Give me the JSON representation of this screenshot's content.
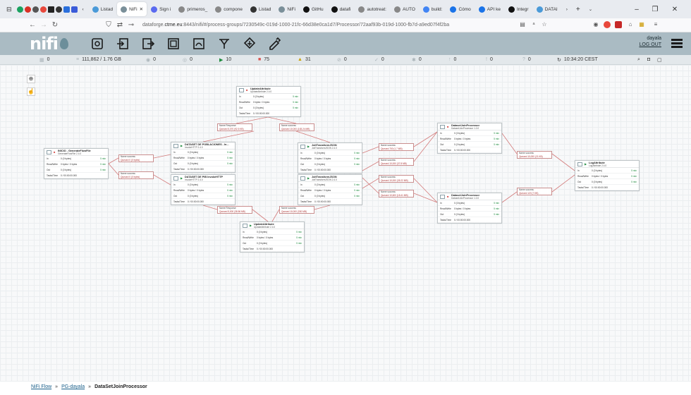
{
  "tabs": [
    {
      "label": "Listad",
      "color": "#4a9ad8"
    },
    {
      "label": "NiFi",
      "color": "#7a8f99",
      "active": true
    },
    {
      "label": "Sign i",
      "color": "#5a6af0"
    },
    {
      "label": "primeros_",
      "color": "#888"
    },
    {
      "label": "compone",
      "color": "#888"
    },
    {
      "label": "Listad",
      "color": "#333"
    },
    {
      "label": "NiFi",
      "color": "#7a8f99"
    },
    {
      "label": "GitHu",
      "color": "#111"
    },
    {
      "label": "datafi",
      "color": "#111"
    },
    {
      "label": "autotreat:",
      "color": "#888"
    },
    {
      "label": "AUTO",
      "color": "#888"
    },
    {
      "label": "build:",
      "color": "#4285f4"
    },
    {
      "label": "Cómo",
      "color": "#1a73e8"
    },
    {
      "label": "API ke",
      "color": "#1a73e8"
    },
    {
      "label": "Integr",
      "color": "#111"
    },
    {
      "label": "DATAI",
      "color": "#4a9ad8"
    }
  ],
  "address": {
    "url_prefix": "dataforge.",
    "url_host": "ctme.eu",
    "url_rest": ":8443/nifi/#/process-groups/7230549c-019d-1000-21fc-66d38e0ca1d7/Processor/72aaf93b-019d-1000-fb7d-a9ed07f4f2ba"
  },
  "header": {
    "logo": "nifi",
    "user": "dayala",
    "logout": "LOG OUT"
  },
  "status": {
    "clusters": "0",
    "flowfiles": "111,862 / 1.76 GB",
    "transmitting": "0",
    "not_transmitting": "0",
    "running": "10",
    "stopped": "75",
    "invalid": "31",
    "disabled": "0",
    "up_to_date": "0",
    "locally_modified": "0",
    "stale": "0",
    "mod_stale": "0",
    "sync_failure": "0",
    "time": "10:34:20 CEST"
  },
  "processors": [
    {
      "id": "p1",
      "name": "UpdateAttribute",
      "type": "UpdateAttribute 2.4.0",
      "in": "0 (0 bytes)",
      "rw": "0 bytes / 0 bytes",
      "out": "0 (0 bytes)",
      "tasks": "0 / 00:00:00.000",
      "t": "5 min"
    },
    {
      "id": "p2",
      "name": "INICIO - GenerateFlowFile",
      "type": "GenerateFlowFile 2.4.0",
      "in": "0 (0 bytes)",
      "rw": "0 bytes / 0 bytes",
      "out": "0 (0 bytes)",
      "tasks": "0 / 00:00:00.000",
      "t": "5 min"
    },
    {
      "id": "p3",
      "name": "DATASET DE POBLACIONES - In...",
      "type": "InvokeHTTP 2.4.0",
      "in": "0 (0 bytes)",
      "rw": "0 bytes / 0 bytes",
      "out": "0 (0 bytes)",
      "tasks": "0 / 00:00:00.000",
      "t": "5 min"
    },
    {
      "id": "p4",
      "name": "DATASET DE PIB InvokeHTTP",
      "type": "InvokeHTTP 2.4.0",
      "in": "0 (0 bytes)",
      "rw": "0 bytes / 0 bytes",
      "out": "0 (0 bytes)",
      "tasks": "0 / 00:00:00.000",
      "t": "5 min"
    },
    {
      "id": "p5",
      "name": "JoltTransformJSON",
      "type": "JoltTransformJSON 2.4.0",
      "in": "0 (0 bytes)",
      "rw": "0 bytes / 0 bytes",
      "out": "0 (0 bytes)",
      "tasks": "0 / 00:00:00.000",
      "t": "5 min"
    },
    {
      "id": "p6",
      "name": "JoltTransformJSON",
      "type": "JoltTransformJSON 2.4.0",
      "in": "0 (0 bytes)",
      "rw": "0 bytes / 0 bytes",
      "out": "0 (0 bytes)",
      "tasks": "0 / 00:00:00.000",
      "t": "5 min"
    },
    {
      "id": "p7",
      "name": "UpdateAttribute",
      "type": "UpdateAttribute 2.4.0",
      "in": "0 (0 bytes)",
      "rw": "0 bytes / 0 bytes",
      "out": "0 (0 bytes)",
      "tasks": "0 / 00:00:00.000",
      "t": "5 min"
    },
    {
      "id": "p8",
      "name": "DatasetJoinProcessor",
      "type": "DatasetJoinProcessor 1.0.0",
      "in": "0 (0 bytes)",
      "rw": "0 bytes / 0 bytes",
      "out": "0 (0 bytes)",
      "tasks": "0 / 00:00:00.000",
      "t": "5 min"
    },
    {
      "id": "p9",
      "name": "DatasetJoinProcessor",
      "type": "DatasetJoinProcessor 1.0.0",
      "in": "0 (0 bytes)",
      "rw": "0 bytes / 0 bytes",
      "out": "0 (0 bytes)",
      "tasks": "0 / 00:00:00.000",
      "t": "5 min"
    },
    {
      "id": "p10",
      "name": "LogAttribute",
      "type": "LogAttribute 2.4.0",
      "in": "0 (0 bytes)",
      "rw": "0 bytes / 0 bytes",
      "out": "0 (0 bytes)",
      "tasks": "0 / 00:00:00.000",
      "t": "5 min"
    }
  ],
  "connections": [
    {
      "name": "Name  Response",
      "queued": "Queued  5,070 (92.5 KB)"
    },
    {
      "name": "Name  success",
      "queued": "Queued  10,000 (183.24 MB)"
    },
    {
      "name": "Name  success",
      "queued": "Queued  0 (0 bytes)"
    },
    {
      "name": "Name  success",
      "queued": "Queued  0 (0 bytes)"
    },
    {
      "name": "Name  success",
      "queued": "Queued  700 (1.7 MB)"
    },
    {
      "name": "Name  success",
      "queued": "Queued  10,000 (37.8 MB)"
    },
    {
      "name": "Name  success",
      "queued": "Queued  10,000 (35.22 MB)"
    },
    {
      "name": "Name  Response",
      "queued": "Queued  5,000 (38.56 MB)"
    },
    {
      "name": "Name  success",
      "queued": "Queued  10,000 (330 MB)"
    },
    {
      "name": "Name  success",
      "queued": "Queued  10,600 (18.41 MB)"
    },
    {
      "name": "Name  success",
      "queued": "Queued  120 (7 KB)"
    },
    {
      "name": "Name  success",
      "queued": "Queued  10,000 (21 KB)"
    }
  ],
  "breadcrumb": {
    "root": "NiFi Flow",
    "group": "PG-dayala",
    "current": "DataSetJoinProcessor",
    "sep": "»"
  },
  "labels": {
    "in": "In",
    "rw": "Read/Write",
    "out": "Out",
    "tasks": "Tasks/Time"
  }
}
